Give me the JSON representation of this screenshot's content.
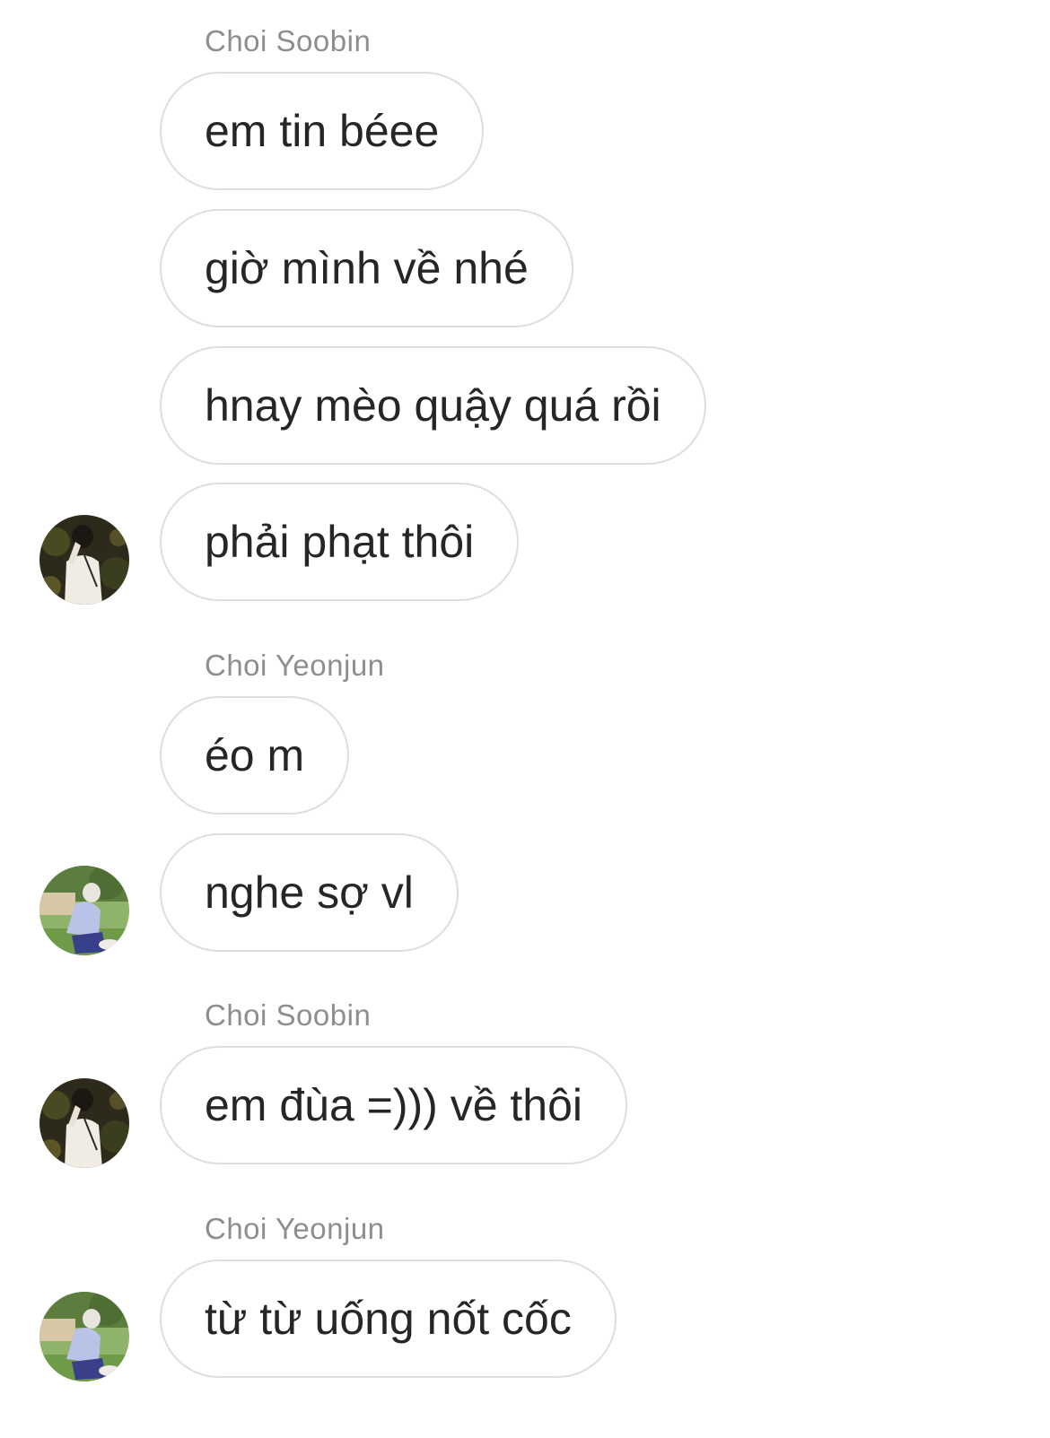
{
  "messages": [
    {
      "sender": "Choi Soobin",
      "lines": [
        "em tin béee",
        "giờ mình về nhé",
        "hnay mèo quậy quá rồi",
        "phải phạt thôi"
      ]
    },
    {
      "sender": "Choi Yeonjun",
      "lines": [
        "éo m",
        "nghe sợ vl"
      ]
    },
    {
      "sender": "Choi Soobin",
      "lines": [
        "em đùa =))) về thôi"
      ]
    },
    {
      "sender": "Choi Yeonjun",
      "lines": [
        "từ từ uống nốt cốc"
      ]
    }
  ],
  "avatars": {
    "soobin": "avatar-dark-garden-photo",
    "yeonjun": "avatar-sunny-park-photo"
  },
  "colors": {
    "bubble_border": "#dedede",
    "sender_name": "#8e8e8e",
    "message_text": "#262626"
  }
}
